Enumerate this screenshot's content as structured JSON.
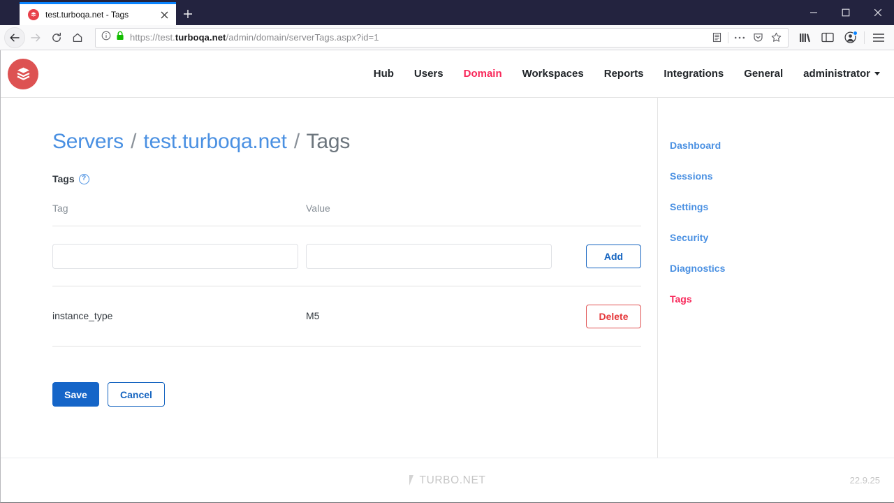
{
  "browser": {
    "tab": {
      "title": "test.turboqa.net - Tags",
      "favicon_icon": "turbo-logo-icon",
      "close_icon": "close-icon"
    },
    "newtab_icon": "plus-icon",
    "window_controls": [
      {
        "name": "minimize-button",
        "icon": "minimize-icon"
      },
      {
        "name": "maximize-button",
        "icon": "maximize-icon"
      },
      {
        "name": "close-window-button",
        "icon": "close-icon"
      }
    ],
    "nav": {
      "back_icon": "back-arrow-icon",
      "forward_icon": "forward-arrow-icon",
      "reload_icon": "reload-icon",
      "home_icon": "home-icon"
    },
    "address": {
      "info_icon": "page-info-icon",
      "lock_icon": "padlock-icon",
      "url_prefix": "https://test.",
      "url_domain": "turboqa.net",
      "url_suffix": "/admin/domain/serverTags.aspx?id=1",
      "full_url": "https://test.turboqa.net/admin/domain/serverTags.aspx?id=1",
      "actions": [
        {
          "name": "reader-view-button",
          "icon": "reader-view-icon"
        },
        {
          "name": "page-actions-button",
          "icon": "ellipsis-icon"
        },
        {
          "name": "pocket-button",
          "icon": "pocket-shield-icon"
        },
        {
          "name": "bookmark-button",
          "icon": "star-icon"
        }
      ]
    },
    "toolbar_right": [
      {
        "name": "library-button",
        "icon": "library-books-icon"
      },
      {
        "name": "sidebar-button",
        "icon": "sidebar-panel-icon"
      },
      {
        "name": "account-button",
        "icon": "account-avatar-icon",
        "badge": true
      },
      {
        "name": "app-menu-button",
        "icon": "hamburger-menu-icon"
      }
    ]
  },
  "app": {
    "logo_icon": "turbo-stack-logo-icon",
    "nav": [
      {
        "label": "Hub",
        "active": false
      },
      {
        "label": "Users",
        "active": false
      },
      {
        "label": "Domain",
        "active": true
      },
      {
        "label": "Workspaces",
        "active": false
      },
      {
        "label": "Reports",
        "active": false
      },
      {
        "label": "Integrations",
        "active": false
      },
      {
        "label": "General",
        "active": false
      }
    ],
    "user_menu": {
      "label": "administrator",
      "caret_icon": "caret-down-icon"
    },
    "colors": {
      "accent_blue": "#4a90e2",
      "accent_red": "#f8285a",
      "primary_button": "#1565c8",
      "danger": "#e5383b"
    }
  },
  "breadcrumb": {
    "servers": "Servers",
    "server": "test.turboqa.net",
    "current": "Tags",
    "separator": "/"
  },
  "section": {
    "label": "Tags",
    "help_icon": "question-mark-icon",
    "help_glyph": "?"
  },
  "table": {
    "headers": {
      "tag": "Tag",
      "value": "Value"
    },
    "new_row": {
      "tag_value": "",
      "tag_placeholder": "",
      "value_value": "",
      "value_placeholder": "",
      "add_label": "Add"
    },
    "rows": [
      {
        "tag": "instance_type",
        "value": "M5",
        "delete_label": "Delete"
      }
    ]
  },
  "form": {
    "save_label": "Save",
    "cancel_label": "Cancel"
  },
  "sidenav": {
    "items": [
      {
        "label": "Dashboard",
        "active": false
      },
      {
        "label": "Sessions",
        "active": false
      },
      {
        "label": "Settings",
        "active": false
      },
      {
        "label": "Security",
        "active": false
      },
      {
        "label": "Diagnostics",
        "active": false
      },
      {
        "label": "Tags",
        "active": true
      }
    ]
  },
  "footer": {
    "brand": "TURBO.NET",
    "brand_mark_icon": "turbo-slash-icon",
    "version": "22.9.25"
  }
}
